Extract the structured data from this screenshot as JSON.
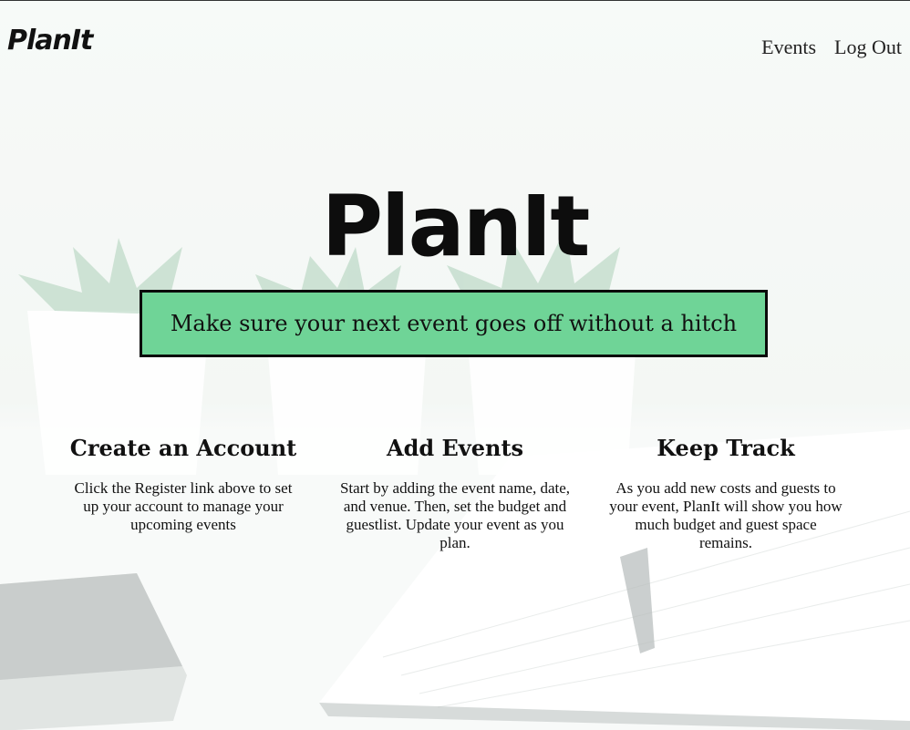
{
  "nav": {
    "logo": "PlanIt",
    "links": [
      "Events",
      "Log Out"
    ]
  },
  "hero": {
    "title": "PlanIt",
    "tagline": "Make sure your next event goes off without a hitch"
  },
  "features": [
    {
      "heading": "Create an Account",
      "text": "Click the Register link above to set up your account to manage your upcoming events"
    },
    {
      "heading": "Add Events",
      "text": "Start by adding the event name, date, and venue. Then, set the budget and guestlist. Update your event as you plan."
    },
    {
      "heading": "Keep Track",
      "text": "As you add new costs and guests to your event, PlanIt will show you how much budget and guest space remains."
    }
  ],
  "colors": {
    "tagline_bg": "#6fd497",
    "border": "#0a0a0a"
  }
}
